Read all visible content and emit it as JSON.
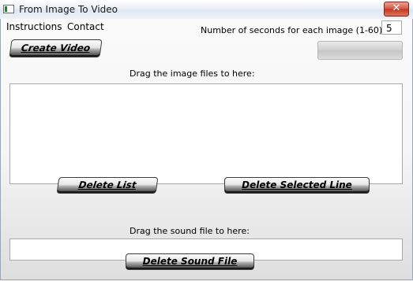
{
  "window": {
    "title": "From Image To Video",
    "close_glyph": "✕"
  },
  "menu": {
    "items": [
      "Instructions",
      "Contact"
    ]
  },
  "seconds": {
    "label": "Number of seconds for each image (1-60):",
    "value": "5"
  },
  "buttons": {
    "create_video": "Create Video",
    "delete_list": "Delete List",
    "delete_selected_line": "Delete Selected Line",
    "delete_sound_file": "Delete Sound File"
  },
  "image_drop": {
    "label": "Drag the image files to here:"
  },
  "sound_drop": {
    "label": "Drag the sound file to here:"
  },
  "progress": {
    "value": 0
  },
  "icons": {
    "app": "app-window-icon",
    "close": "close-icon"
  },
  "colors": {
    "close_red": "#c3371f",
    "titlebar": "#dfe7f1",
    "window_bg": "#f0f0f0"
  }
}
